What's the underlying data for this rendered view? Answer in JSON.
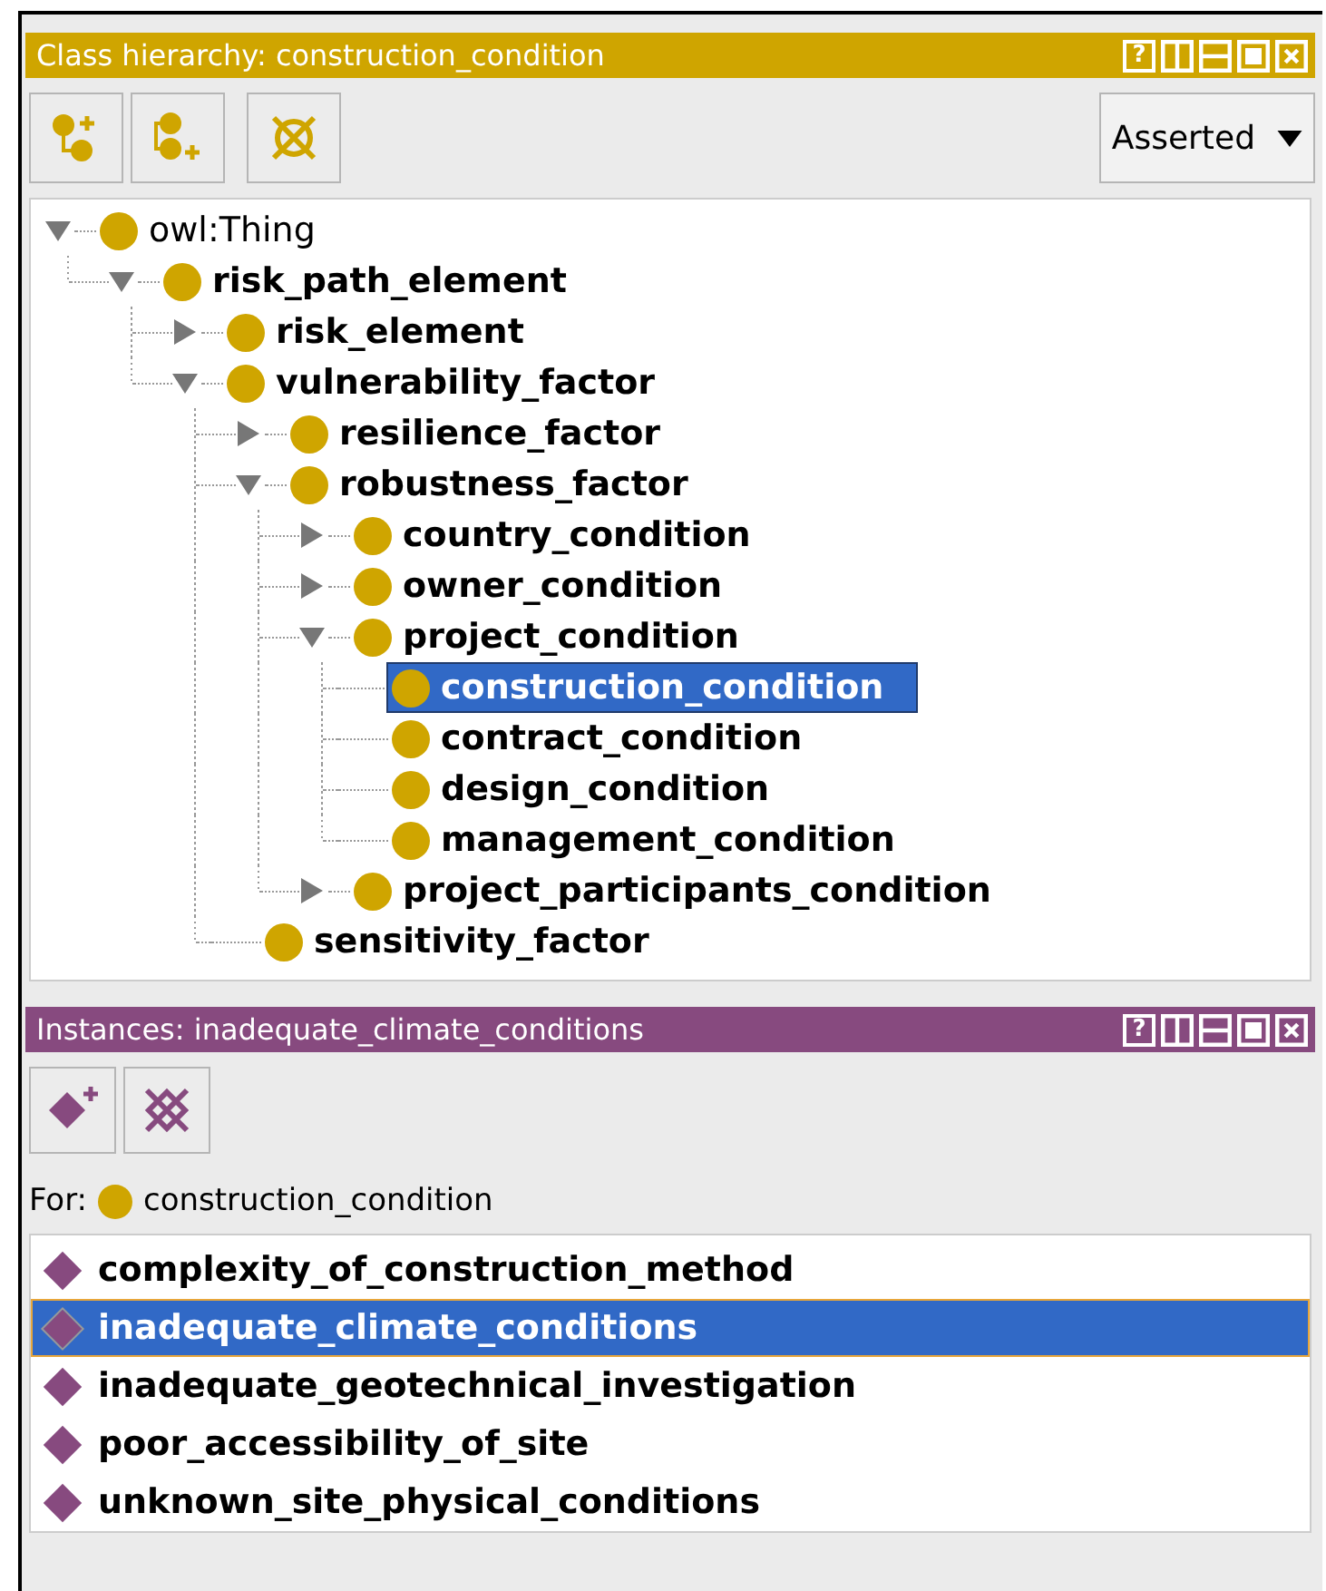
{
  "class_panel": {
    "title": "Class hierarchy: construction_condition",
    "help": "?",
    "view": "Asserted",
    "tree": [
      {
        "label": "owl:Thing",
        "kind": "root",
        "expanded": true,
        "selected": false,
        "children": [
          {
            "label": "risk_path_element",
            "kind": "class",
            "expanded": true,
            "selected": false,
            "children": [
              {
                "label": "risk_element",
                "kind": "class",
                "expanded": false,
                "selected": false
              },
              {
                "label": "vulnerability_factor",
                "kind": "class",
                "expanded": true,
                "selected": false,
                "children": [
                  {
                    "label": "resilience_factor",
                    "kind": "class",
                    "expanded": false,
                    "selected": false
                  },
                  {
                    "label": "robustness_factor",
                    "kind": "class",
                    "expanded": true,
                    "selected": false,
                    "children": [
                      {
                        "label": "country_condition",
                        "kind": "class",
                        "expanded": false,
                        "selected": false
                      },
                      {
                        "label": "owner_condition",
                        "kind": "class",
                        "expanded": false,
                        "selected": false
                      },
                      {
                        "label": "project_condition",
                        "kind": "class",
                        "expanded": true,
                        "selected": false,
                        "children": [
                          {
                            "label": "construction_condition",
                            "kind": "class",
                            "selected": true
                          },
                          {
                            "label": "contract_condition",
                            "kind": "class",
                            "selected": false
                          },
                          {
                            "label": "design_condition",
                            "kind": "class",
                            "selected": false
                          },
                          {
                            "label": "management_condition",
                            "kind": "class",
                            "selected": false
                          }
                        ]
                      },
                      {
                        "label": "project_participants_condition",
                        "kind": "class",
                        "expanded": false,
                        "selected": false
                      }
                    ]
                  },
                  {
                    "label": "sensitivity_factor",
                    "kind": "class",
                    "selected": false
                  }
                ]
              }
            ]
          }
        ]
      }
    ]
  },
  "instances_panel": {
    "title": "Instances: inadequate_climate_conditions",
    "help": "?",
    "for_label": "For:",
    "for_class": "construction_condition",
    "items": [
      {
        "label": "complexity_of_construction_method",
        "selected": false
      },
      {
        "label": "inadequate_climate_conditions",
        "selected": true
      },
      {
        "label": "inadequate_geotechnical_investigation",
        "selected": false
      },
      {
        "label": "poor_accessibility_of_site",
        "selected": false
      },
      {
        "label": "unknown_site_physical_conditions",
        "selected": false
      }
    ]
  }
}
